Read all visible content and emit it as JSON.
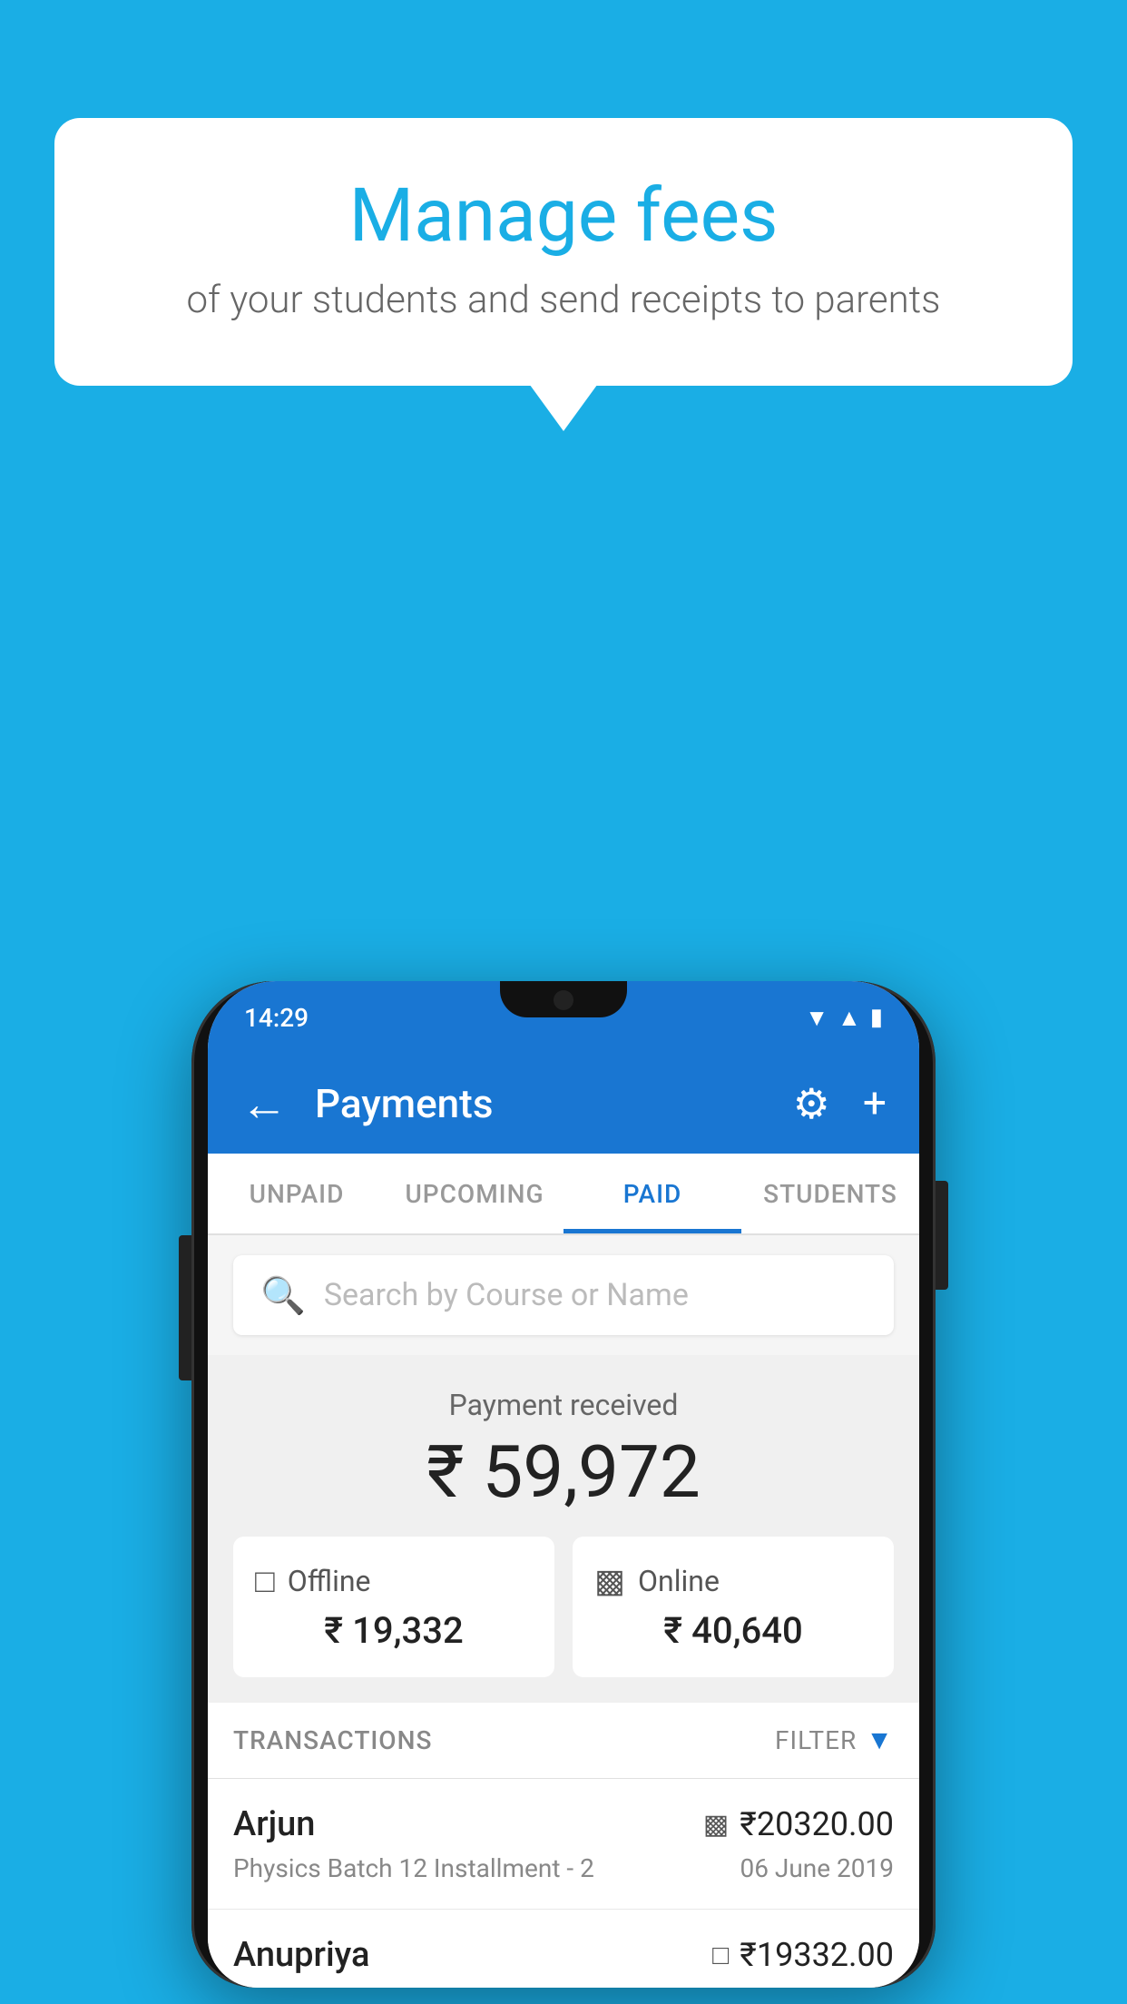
{
  "page": {
    "background_color": "#1aaee5"
  },
  "speech_bubble": {
    "title": "Manage fees",
    "subtitle": "of your students and send receipts to parents"
  },
  "status_bar": {
    "time": "14:29",
    "wifi_icon": "▼",
    "signal_icon": "▲",
    "battery_icon": "▮"
  },
  "header": {
    "back_label": "←",
    "title": "Payments",
    "settings_icon": "⚙",
    "add_icon": "+"
  },
  "tabs": [
    {
      "id": "unpaid",
      "label": "UNPAID",
      "active": false
    },
    {
      "id": "upcoming",
      "label": "UPCOMING",
      "active": false
    },
    {
      "id": "paid",
      "label": "PAID",
      "active": true
    },
    {
      "id": "students",
      "label": "STUDENTS",
      "active": false
    }
  ],
  "search": {
    "placeholder": "Search by Course or Name"
  },
  "payment_summary": {
    "label": "Payment received",
    "total": "₹ 59,972",
    "offline_label": "Offline",
    "offline_amount": "₹ 19,332",
    "online_label": "Online",
    "online_amount": "₹ 40,640"
  },
  "transactions": {
    "section_label": "TRANSACTIONS",
    "filter_label": "FILTER",
    "items": [
      {
        "name": "Arjun",
        "course": "Physics Batch 12 Installment - 2",
        "amount": "₹20320.00",
        "date": "06 June 2019",
        "payment_mode": "online"
      },
      {
        "name": "Anupriya",
        "course": "",
        "amount": "₹19332.00",
        "date": "",
        "payment_mode": "offline"
      }
    ]
  }
}
